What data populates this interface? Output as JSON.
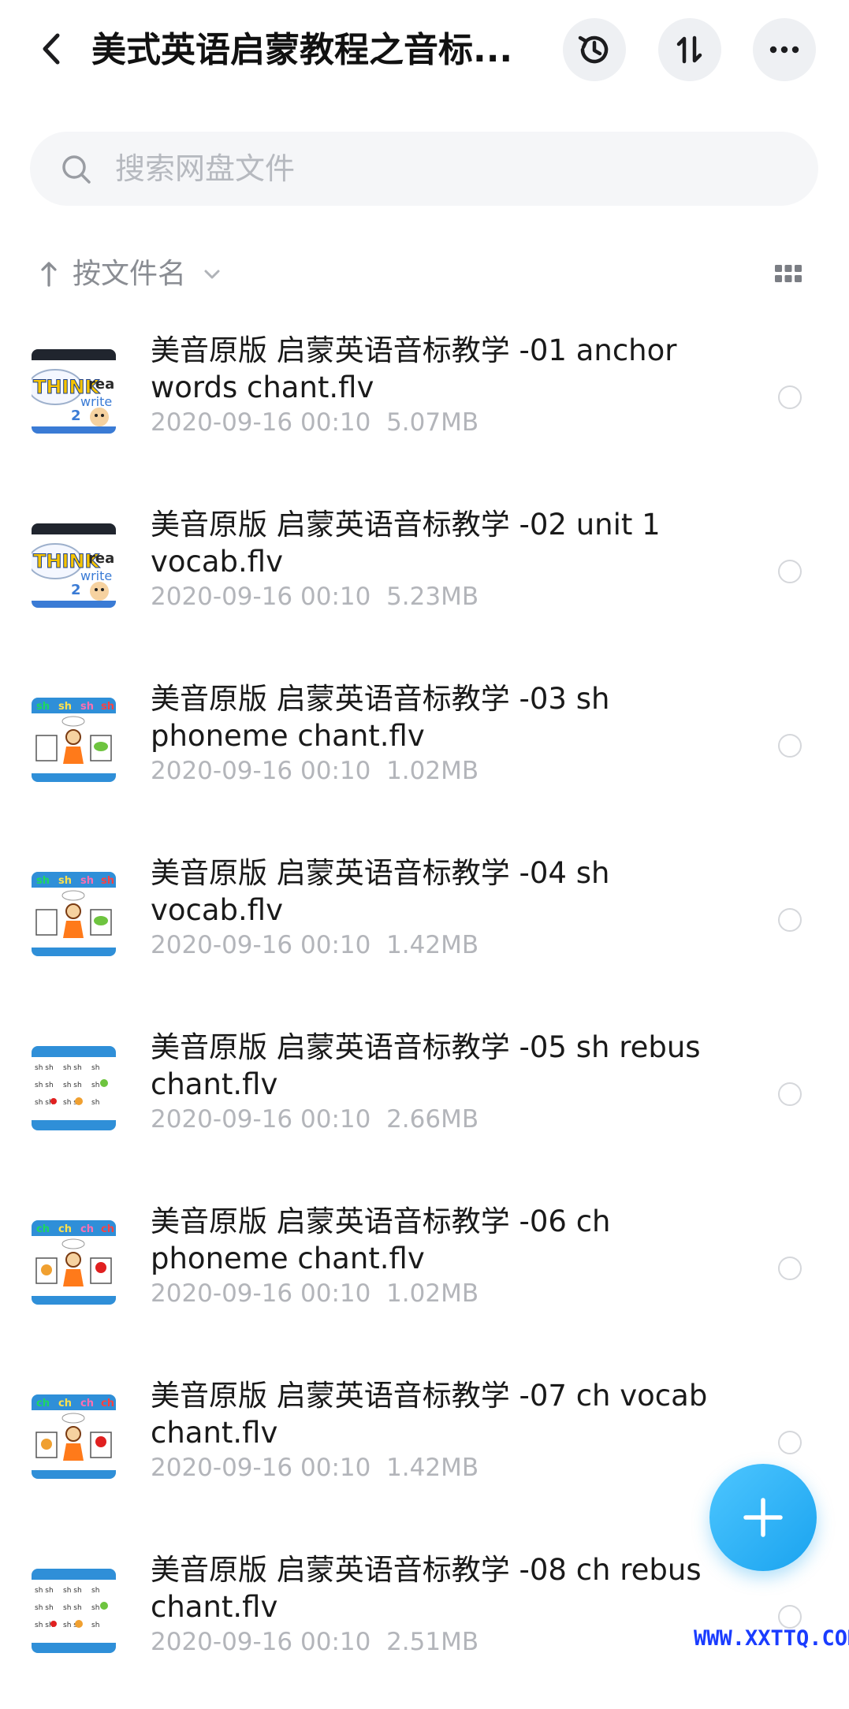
{
  "header": {
    "title": "美式英语启蒙教程之音标...",
    "back_icon": "chevron-left-icon",
    "history_icon": "history-icon",
    "sort_icon": "sort-icon",
    "more_icon": "more-icon"
  },
  "search": {
    "placeholder": "搜索网盘文件",
    "icon": "search-icon"
  },
  "sortbar": {
    "label": "按文件名",
    "arrow_icon": "arrow-up-icon",
    "dropdown_icon": "chevron-down-icon",
    "view_icon": "grid-view-icon"
  },
  "files": [
    {
      "name": "美音原版 启蒙英语音标教学 -01 anchor words chant.flv",
      "date": "2020-09-16  00:10",
      "size": "5.07MB",
      "thumb": "think"
    },
    {
      "name": "美音原版 启蒙英语音标教学 -02 unit 1 vocab.flv",
      "date": "2020-09-16  00:10",
      "size": "5.23MB",
      "thumb": "think"
    },
    {
      "name": "美音原版 启蒙英语音标教学 -03 sh phoneme chant.flv",
      "date": "2020-09-16  00:10",
      "size": "1.02MB",
      "thumb": "sh"
    },
    {
      "name": "美音原版 启蒙英语音标教学 -04 sh vocab.flv",
      "date": "2020-09-16  00:10",
      "size": "1.42MB",
      "thumb": "sh"
    },
    {
      "name": "美音原版 启蒙英语音标教学 -05 sh rebus chant.flv",
      "date": "2020-09-16  00:10",
      "size": "2.66MB",
      "thumb": "rebus"
    },
    {
      "name": "美音原版 启蒙英语音标教学 -06 ch phoneme chant.flv",
      "date": "2020-09-16  00:10",
      "size": "1.02MB",
      "thumb": "ch"
    },
    {
      "name": "美音原版 启蒙英语音标教学 -07 ch vocab chant.flv",
      "date": "2020-09-16  00:10",
      "size": "1.42MB",
      "thumb": "ch"
    },
    {
      "name": "美音原版 启蒙英语音标教学 -08 ch rebus chant.flv",
      "date": "2020-09-16  00:10",
      "size": "2.51MB",
      "thumb": "rebus"
    }
  ],
  "fab": {
    "icon": "plus-icon"
  },
  "watermark": "WWW.XXTTQ.COM",
  "colors": {
    "accent": "#1aa3ef",
    "muted": "#b3b5ba",
    "watermark": "#1a3cff"
  }
}
